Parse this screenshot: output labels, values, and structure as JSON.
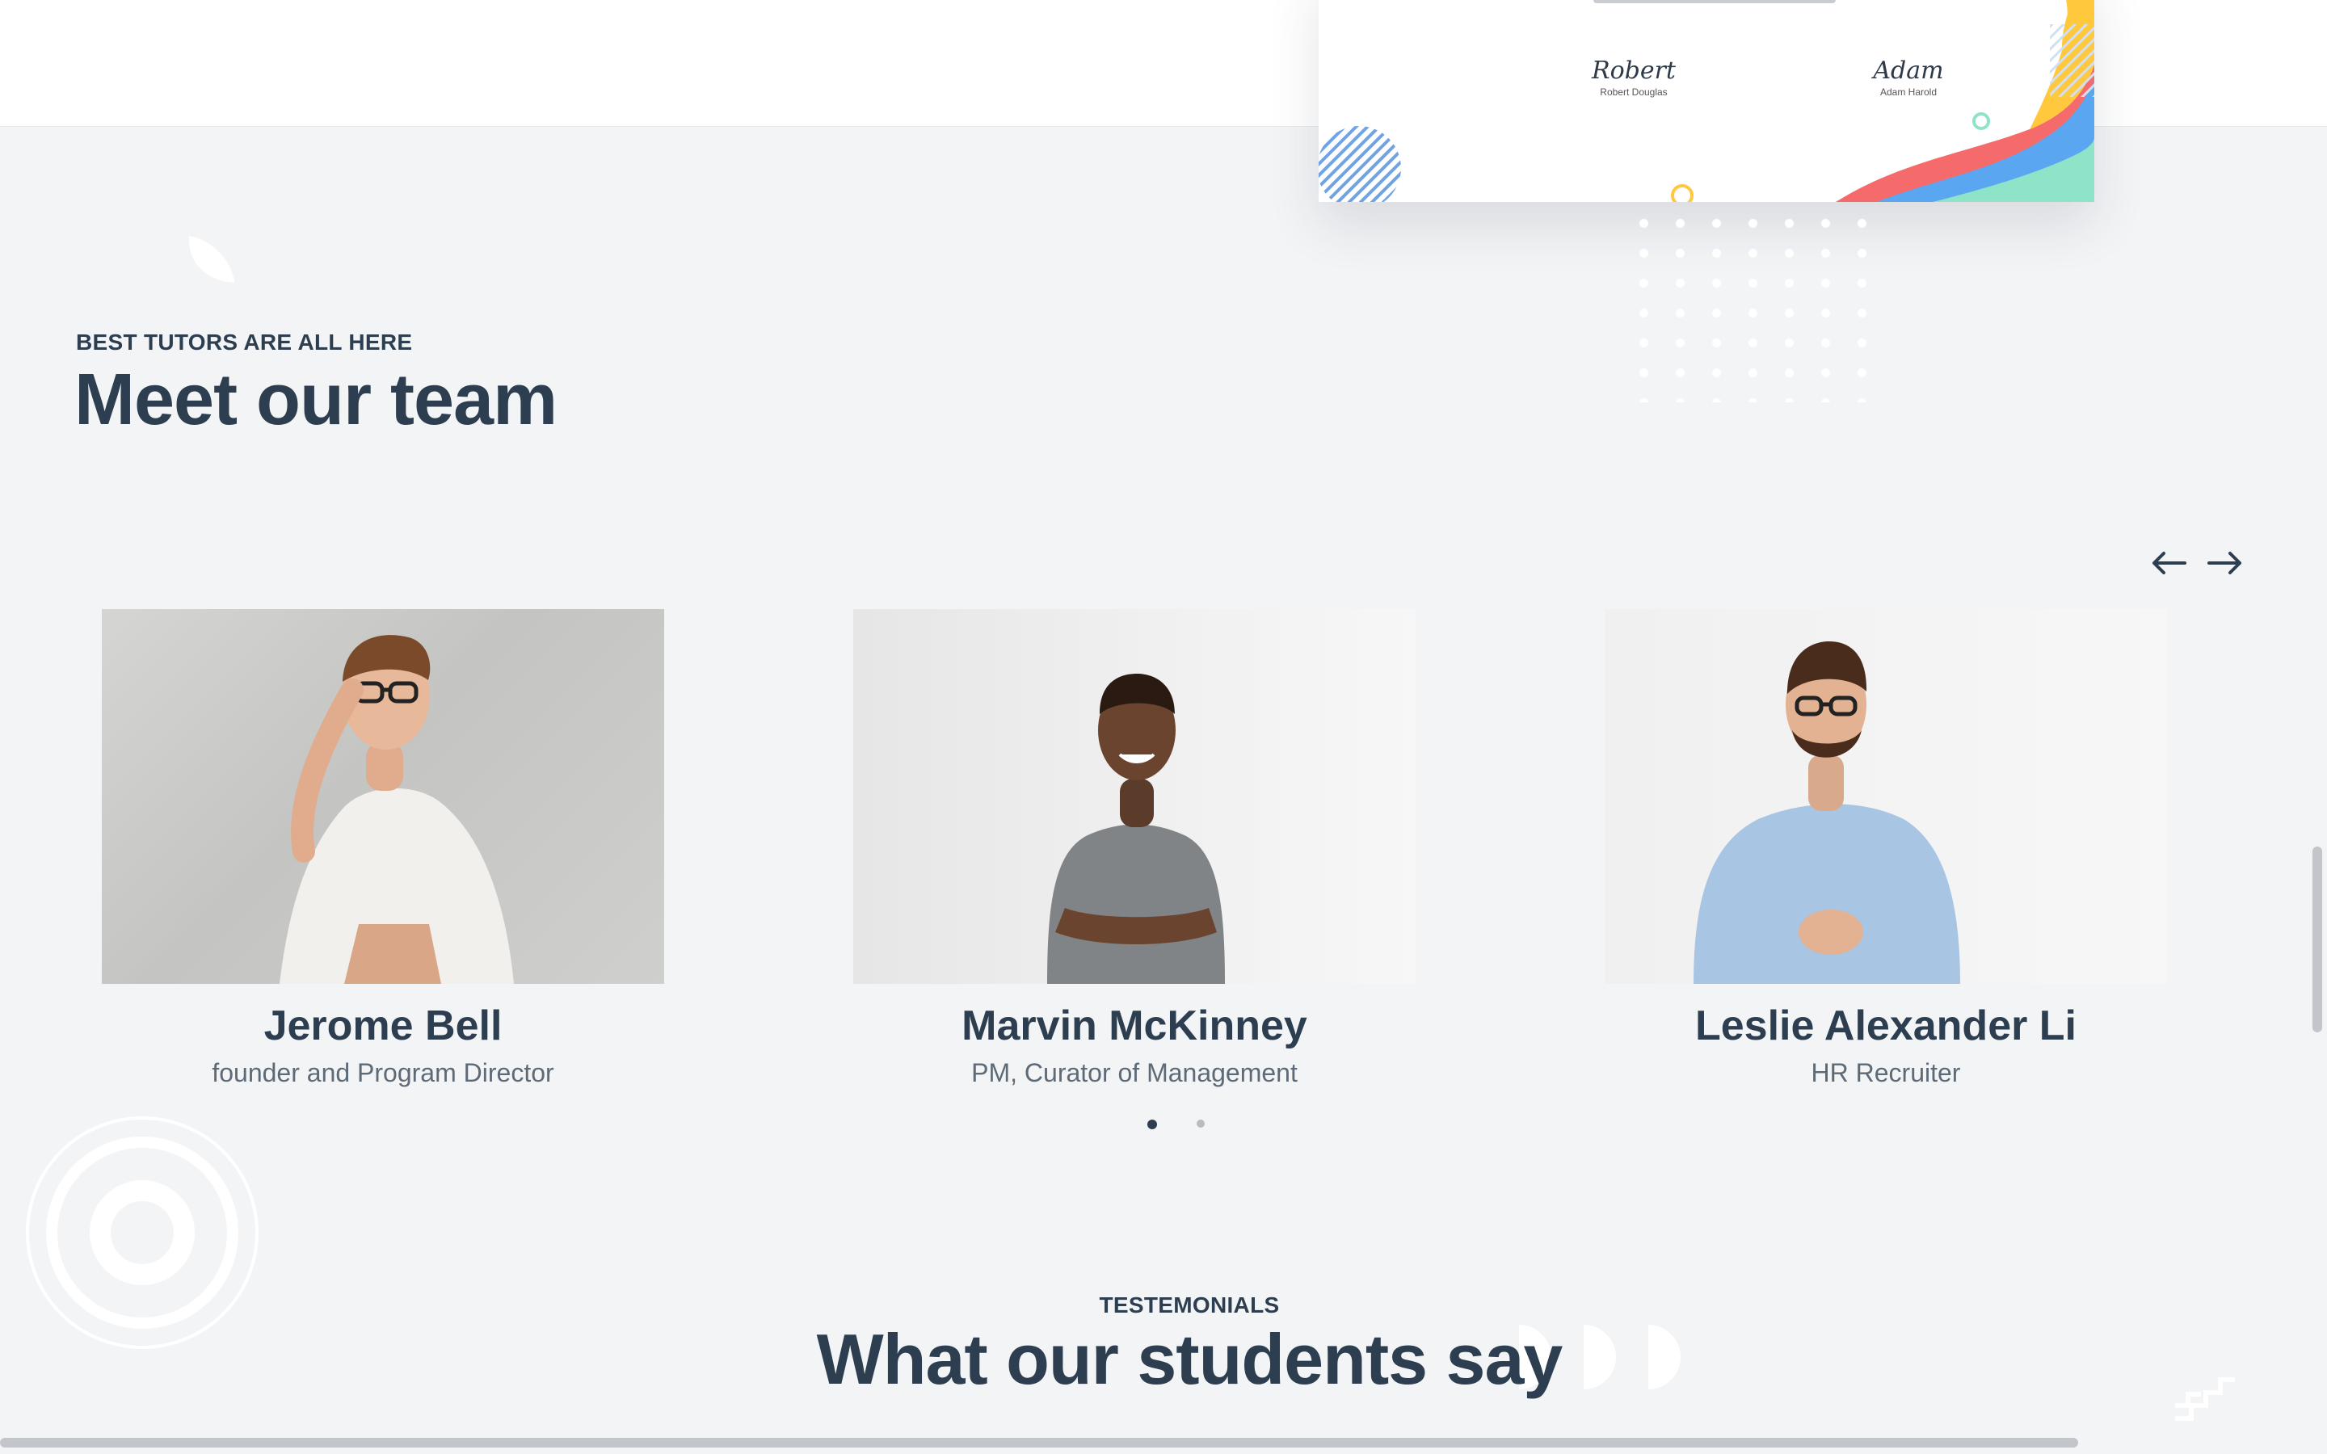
{
  "certificate": {
    "signatures": [
      {
        "script": "Robert",
        "name": "Robert Douglas"
      },
      {
        "script": "Adam",
        "name": "Adam Harold"
      }
    ]
  },
  "team": {
    "eyebrow": "BEST TUTORS ARE ALL HERE",
    "title": "Meet our team",
    "prev_icon": "arrow-left-icon",
    "next_icon": "arrow-right-icon",
    "members": [
      {
        "name": "Jerome Bell",
        "role": "founder and Program Director"
      },
      {
        "name": "Marvin McKinney",
        "role": "PM, Curator of Management"
      },
      {
        "name": "Leslie Alexander Li",
        "role": "HR Recruiter"
      }
    ],
    "pager": {
      "pages": 2,
      "active": 1
    }
  },
  "testimonials": {
    "eyebrow": "TESTEMONIALS",
    "title": "What our students say"
  },
  "colors": {
    "heading": "#2d3e50",
    "muted": "#5e6a76",
    "background": "#f3f4f6",
    "accent_yellow": "#ffc83d",
    "accent_blue": "#5aa6f0",
    "accent_red": "#f56b6b",
    "accent_mint": "#8fe3c8"
  }
}
